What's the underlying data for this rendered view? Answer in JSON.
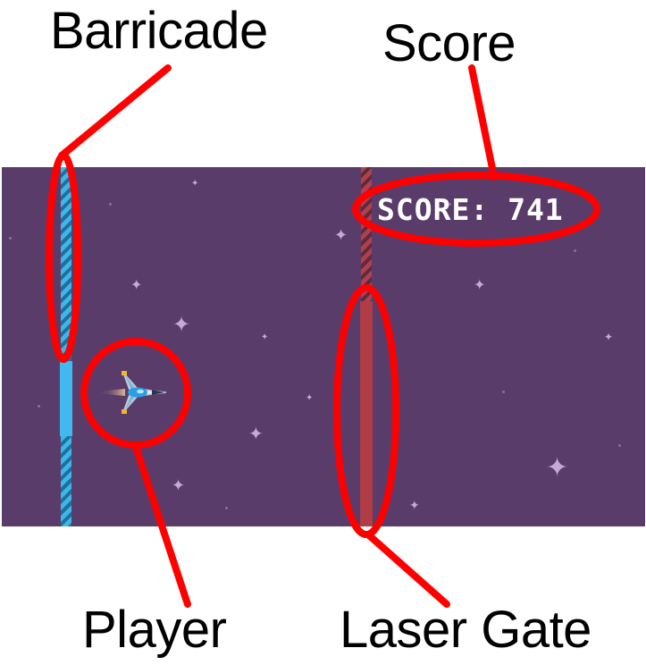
{
  "labels": {
    "barricade": "Barricade",
    "score": "Score",
    "player": "Player",
    "laser_gate": "Laser Gate"
  },
  "hud": {
    "score_text": "SCORE: 741"
  },
  "icons": [
    "star-icon",
    "player-ship-icon"
  ],
  "colors": {
    "background": "#5a3c6a",
    "callout": "#ff0000",
    "barricade": "#42b9ee",
    "laser": "#b03c46",
    "score": "#ffffff"
  }
}
